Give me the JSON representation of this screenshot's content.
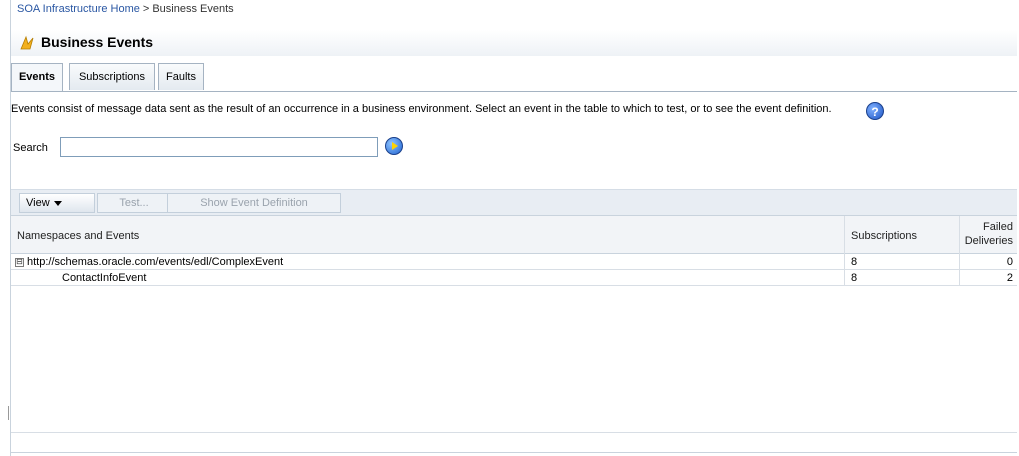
{
  "breadcrumb": {
    "home": "SOA Infrastructure Home",
    "separator": ">",
    "current": "Business Events"
  },
  "header": {
    "title": "Business Events",
    "icon": "business-events-icon"
  },
  "tabs": [
    {
      "label": "Events",
      "active": true
    },
    {
      "label": "Subscriptions",
      "active": false
    },
    {
      "label": "Faults",
      "active": false
    }
  ],
  "description": "Events consist of message data sent as the result of an occurrence in a business environment. Select an event in the table to which to test, or to see the event definition.",
  "help_icon": "?",
  "search": {
    "label": "Search",
    "value": "",
    "placeholder": ""
  },
  "toolbar": {
    "view_label": "View",
    "test_label": "Test...",
    "show_def_label": "Show Event Definition"
  },
  "table": {
    "columns": [
      "Namespaces and Events",
      "Subscriptions",
      "Failed",
      "Deliveries"
    ],
    "rows": [
      {
        "name": "http://schemas.oracle.com/events/edl/ComplexEvent",
        "expander": "⊟",
        "subscriptions": "8",
        "failed": "0"
      },
      {
        "name": "ContactInfoEvent",
        "subscriptions": "8",
        "failed": "2"
      }
    ]
  },
  "colors": {
    "link": "#2a57a3",
    "toolbar_bg": "#e8edf3",
    "header_bg": "#f2f4f7",
    "disabled_text": "#9aa3ad"
  }
}
